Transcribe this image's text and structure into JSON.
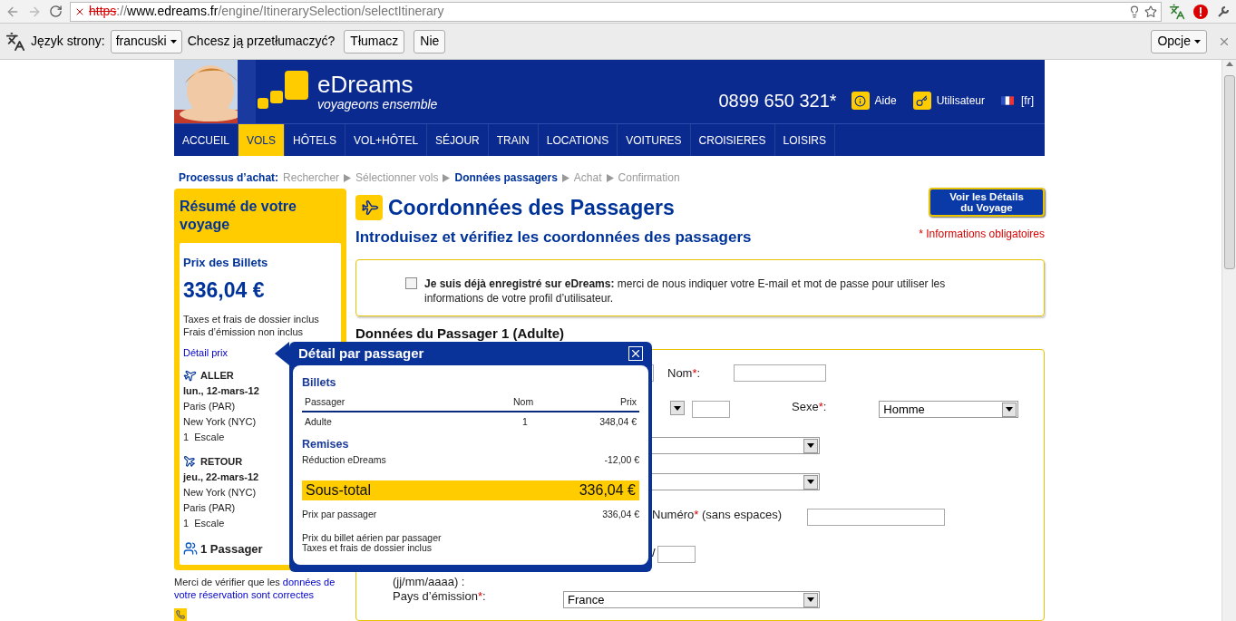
{
  "browser": {
    "url_scheme": "https",
    "url_separator": "://",
    "url_host": "www.edreams.fr",
    "url_path": "/engine/ItinerarySelection/selectItinerary"
  },
  "translate_bar": {
    "label": "Język strony:",
    "language": "francuski",
    "question": "Chcesz ją przetłumaczyć?",
    "buttons": [
      "Tłumacz",
      "Nie"
    ],
    "options": "Opcje"
  },
  "header": {
    "logo": "eDreams",
    "tagline": "voyageons ensemble",
    "phone": "0899 650 321*",
    "links": [
      {
        "kind": "help",
        "label": "Aide"
      },
      {
        "kind": "user",
        "label": "Utilisateur"
      }
    ],
    "language": "[fr]"
  },
  "nav": [
    {
      "label": "ACCUEIL",
      "selected": false
    },
    {
      "label": "VOLS",
      "selected": true
    },
    {
      "label": "HÔTELS",
      "selected": false
    },
    {
      "label": "VOL+HÔTEL",
      "selected": false
    },
    {
      "label": "SÉJOUR",
      "selected": false
    },
    {
      "label": "TRAIN",
      "selected": false
    },
    {
      "label": "LOCATIONS",
      "selected": false
    },
    {
      "label": "VOITURES",
      "selected": false
    },
    {
      "label": "CROISIERES",
      "selected": false
    },
    {
      "label": "LOISIRS",
      "selected": false
    }
  ],
  "breadcrumb": {
    "label": "Processus d’achat:",
    "steps": [
      {
        "label": "Rechercher",
        "selected": false
      },
      {
        "label": "Sélectionner vols",
        "selected": false
      },
      {
        "label": "Données passagers",
        "selected": true
      },
      {
        "label": "Achat",
        "selected": false
      },
      {
        "label": "Confirmation",
        "selected": false
      }
    ]
  },
  "summary": {
    "title": "Résumé de votre voyage",
    "price_title": "Prix des Billets",
    "price": "336,04 €",
    "notes": [
      "Taxes et frais de dossier inclus",
      "Frais d’émission non inclus"
    ],
    "detail_link": "Détail prix",
    "legs": [
      {
        "kind": "outbound",
        "label": "ALLER",
        "date": "lun., 12-mars-12",
        "from": "Paris (PAR)",
        "to": "New York (NYC)",
        "stops": "1  Escale"
      },
      {
        "kind": "return",
        "label": "RETOUR",
        "date": "jeu., 22-mars-12",
        "from": "New York (NYC)",
        "to": "Paris (PAR)",
        "stops": "1  Escale"
      }
    ],
    "passengers": "1 Passager",
    "footer_text": "Merci de vérifier que les ",
    "footer_link": [
      "données de",
      "votre réservation sont correctes"
    ]
  },
  "main": {
    "title": "Coordonnées des Passagers",
    "subtitle": "Introduisez et vérifiez les coordonnées des passagers",
    "details_button": [
      "Voir les Détails",
      "du Voyage"
    ],
    "required_note": "* Informations obligatoires",
    "login": {
      "checked": false,
      "text": "**Je suis déjà enregistré sur eDreams:** merci de nous indiquer votre E-mail et mot de passe pour utiliser les informations de votre profil d’utilisateur."
    },
    "section_title": "Données du Passager 1 (Adulte)",
    "fields": [
      {
        "kind": "text",
        "label": "Nom",
        "required_mark": "*",
        "suffix": ":"
      },
      {
        "kind": "select",
        "label": "Sexe",
        "required_mark": "*",
        "suffix": ":",
        "value": "Homme"
      },
      {
        "kind": "text",
        "label": "Numéro",
        "required_mark": "*",
        "suffix": " (sans espaces)"
      },
      {
        "kind": "date",
        "label": "(jj/mm/aaaa) :",
        "separator": "/"
      },
      {
        "kind": "select",
        "label": "Pays d’émission",
        "required_mark": "*",
        "suffix": ":",
        "value": "France"
      }
    ]
  },
  "popup": {
    "title": "Détail par passager",
    "tickets_title": "Billets",
    "columns": [
      "Passager",
      "Nom",
      "Prix"
    ],
    "row": [
      "Adulte",
      "1",
      "348,04 €"
    ],
    "discounts_title": "Remises",
    "discount": [
      "Réduction eDreams",
      "-12,00 €"
    ],
    "subtotal": [
      "Sous-total",
      "336,04 €"
    ],
    "per_passenger": [
      "Prix par passager",
      "336,04 €"
    ],
    "notes": [
      "Prix du billet aérien par passager",
      "Taxes et frais de dossier inclus"
    ]
  }
}
